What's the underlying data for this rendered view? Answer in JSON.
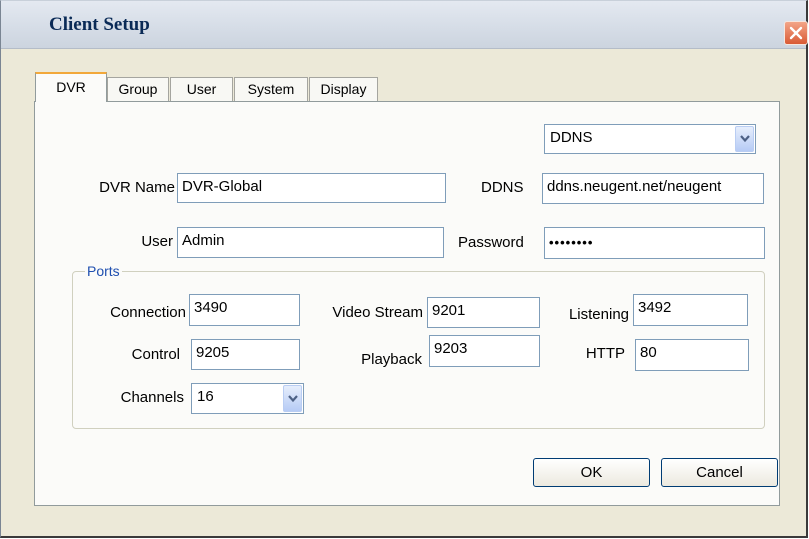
{
  "window": {
    "title": "Client Setup"
  },
  "tabs": [
    {
      "label": "DVR",
      "active": true
    },
    {
      "label": "Group",
      "active": false
    },
    {
      "label": "User",
      "active": false
    },
    {
      "label": "System",
      "active": false
    },
    {
      "label": "Display",
      "active": false
    }
  ],
  "dvr": {
    "name_label": "DVR Name",
    "name_value": "DVR-Global",
    "user_label": "User",
    "user_value": "Admin",
    "ddns_select": "DDNS",
    "ddns_label": "DDNS",
    "ddns_value": "ddns.neugent.net/neugent",
    "password_label": "Password",
    "password_value": "••••••••"
  },
  "ports": {
    "title": "Ports",
    "connection_label": "Connection",
    "connection_value": "3490",
    "video_stream_label": "Video Stream",
    "video_stream_value": "9201",
    "listening_label": "Listening",
    "listening_value": "3492",
    "control_label": "Control",
    "control_value": "9205",
    "playback_label": "Playback",
    "playback_value": "9203",
    "http_label": "HTTP",
    "http_value": "80",
    "channels_label": "Channels",
    "channels_value": "16"
  },
  "buttons": {
    "ok": "OK",
    "cancel": "Cancel"
  },
  "colors": {
    "tab_highlight": "#f2a83a",
    "group_title": "#1f4fb0",
    "close_button": "#d95a35"
  }
}
